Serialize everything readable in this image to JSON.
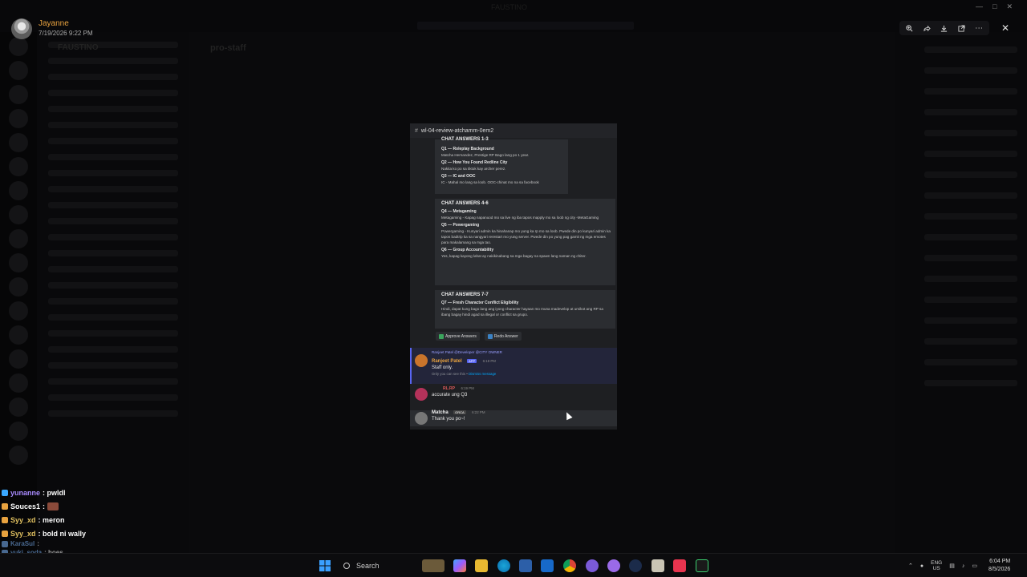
{
  "window": {
    "title": "FAUSTINO"
  },
  "viewer": {
    "uploader_name": "Jayanne",
    "uploader_date": "7/19/2026 9:22 PM",
    "tools": [
      "zoom-in-icon",
      "forward-icon",
      "download-icon",
      "open-external-icon",
      "more-icon"
    ],
    "close_icon": "close-icon"
  },
  "background_app": {
    "server_name": "FAUSTINO",
    "channel_name": "pro-staff"
  },
  "image": {
    "channel_header": "wl-04-review-atchamm-0em2",
    "embed1": {
      "title": "CHAT ANSWERS 1-3",
      "qa": [
        {
          "q": "Q1 — Roleplay Background",
          "a": "Matcha Hernandez, Prestige RP Bago lang po 1 year."
        },
        {
          "q": "Q2 — How You Found Redline City",
          "a": "Nakita ko po sa tiktok kay archer perez."
        },
        {
          "q": "Q3 — IC and OOC",
          "a": "IC - Mahal mo lang sa loob. OOC-chinat mo na sa facebook"
        }
      ]
    },
    "embed2": {
      "title": "CHAT ANSWERS 4-6",
      "qa": [
        {
          "q": "Q4 — Metagaming",
          "a": "Metagaming - Kapag napanuod mo sa live ng iba tapos mapply mo sa loob ng city -MetaGaming"
        },
        {
          "q": "Q5 — Powergaming",
          "a": "Powergaming - Kunyari admin ka hinahanap mo yung ka rp mo sa loob. Pwede din po kunyari admin ka tapos badtrip ka sa nangyari rerestart mo yung server. Pwede din po yung pag gamit ng mga emotes para makalamang sa mga tao."
        },
        {
          "q": "Q6 — Group Accountability",
          "a": "Yes, kapag kayong lahat ay nakikinabang sa mga bagay na spawn lang naman ng chiter."
        }
      ]
    },
    "embed3": {
      "title": "CHAT ANSWERS 7-7",
      "qa": [
        {
          "q": "Q7 — Fresh Character Conflict Eligibility",
          "a": "Hindi, dapat kung bago lang ang iyong character hayaan mo muna madevelop at umikot ang RP sa ibang bagay hindi agad sa illegal or conflict sa grupo."
        }
      ]
    },
    "buttons": {
      "approve": "Approve Answers",
      "redo": "Redo Answer"
    },
    "messages": [
      {
        "reply_to": "Ranjeet Patel @Developer @CITY OWNER",
        "name": "Ranjeet Patel",
        "tag": "APP",
        "time": "6:18 PM",
        "text": "Staff only.",
        "sub": "Only you can see this •",
        "sub_link": "Dismiss message",
        "name_color": "#e8a23f"
      },
      {
        "name": "RL.RP",
        "time": "6:19 PM",
        "text": "accurate ung Q3",
        "name_color": "#e05b5b"
      },
      {
        "name": "Matcha",
        "role": "ORCA",
        "time": "6:22 PM",
        "text": "Thank you po~!",
        "name_color": "#f0f0f0"
      }
    ]
  },
  "overlay_chat": [
    {
      "user": "yunanne",
      "text": ": pwldl",
      "color": "#a98bff",
      "badge": "#3aa8ff"
    },
    {
      "user": "Souces1",
      "text": ":",
      "color": "#ffffff",
      "badge": "#e8a23f",
      "emote": true
    },
    {
      "user": "Syy_xd",
      "text": ": meron",
      "color": "#e0c060",
      "badge": "#e8a23f"
    },
    {
      "user": "Syy_xd",
      "text": ": bold ni wally",
      "color": "#e0c060",
      "badge": "#e8a23f"
    },
    {
      "user": "KaraSul",
      "text": ":",
      "color": "#7fb8ff",
      "badge": "#7fb8ff",
      "faded": true
    },
    {
      "user": "yuki_soda",
      "text": ": hoes",
      "color": "#7fb8ff",
      "badge": "#7fb8ff",
      "faded": true
    }
  ],
  "taskbar": {
    "search_label": "Search",
    "apps": [
      "start-icon",
      "widgets-icon",
      "copilot-icon",
      "file-explorer-icon",
      "edge-icon",
      "store-icon",
      "outlook-icon",
      "chrome-icon",
      "discord-icon",
      "discord-ptb-icon",
      "steam-icon",
      "notes-icon",
      "music-icon",
      "terminal-icon"
    ],
    "lang_top": "ENG",
    "lang_bottom": "US",
    "time": "6:04 PM",
    "date": "8/5/2026"
  }
}
